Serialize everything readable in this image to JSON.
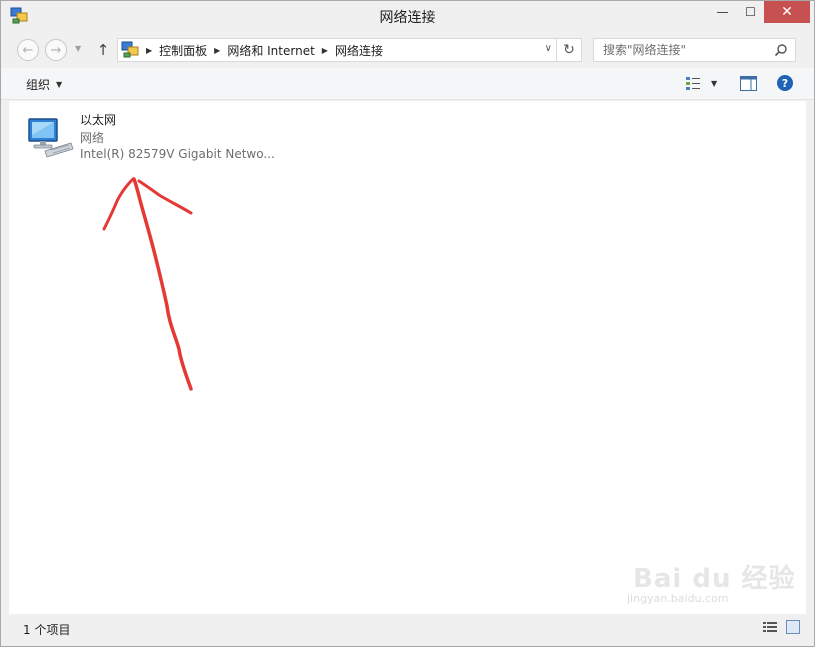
{
  "window": {
    "title": "网络连接",
    "minimize_glyph": "—",
    "maximize_glyph": "☐",
    "close_glyph": "✕"
  },
  "nav": {
    "back_glyph": "←",
    "forward_glyph": "→",
    "recent_glyph": "▼",
    "up_glyph": "↑"
  },
  "address": {
    "breadcrumb": [
      "控制面板",
      "网络和 Internet",
      "网络连接"
    ],
    "dropdown_glyph": "∨",
    "refresh_glyph": "↻"
  },
  "search": {
    "placeholder": "搜索\"网络连接\"",
    "icon": "search-icon"
  },
  "commandbar": {
    "organize_label": "组织",
    "caret_glyph": "▼",
    "help_glyph": "?"
  },
  "items": [
    {
      "name": "以太网",
      "status": "网络",
      "adapter": "Intel(R) 82579V Gigabit Netwo...",
      "icon": "ethernet-icon"
    }
  ],
  "statusbar": {
    "count": "1 个项目"
  },
  "watermark": {
    "brand": "Bai du 经验",
    "url": "jingyan.baidu.com"
  },
  "colors": {
    "annotation_arrow": "#e53935",
    "close_button": "#c75050",
    "help_icon": "#1e63b5"
  }
}
